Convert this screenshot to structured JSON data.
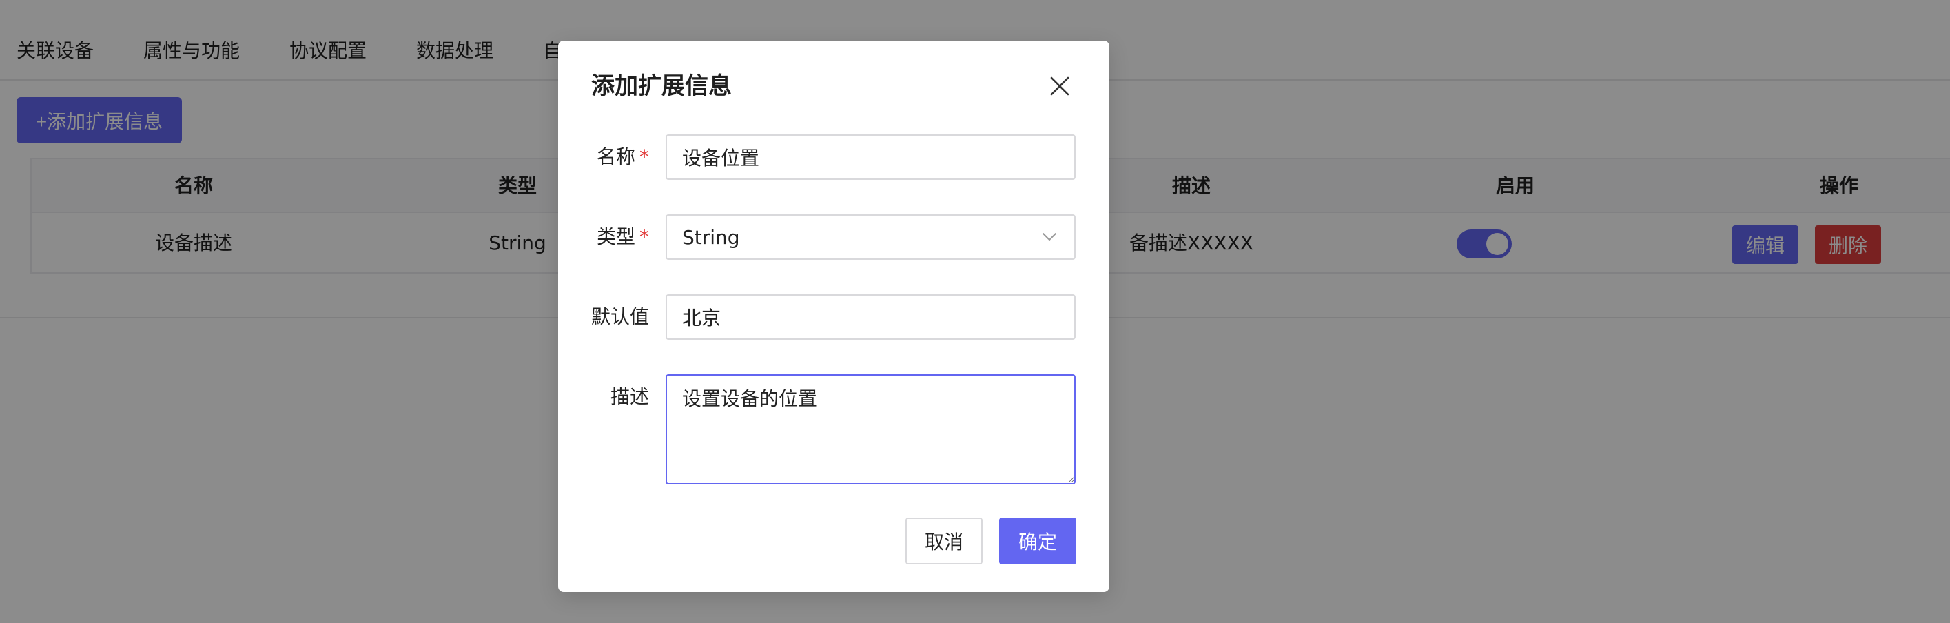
{
  "tabs": [
    "关联设备",
    "属性与功能",
    "协议配置",
    "数据处理",
    "自"
  ],
  "toolbar": {
    "add_label": "+添加扩展信息"
  },
  "table": {
    "columns": [
      "名称",
      "类型",
      "描述",
      "启用",
      "操作"
    ],
    "rows": [
      {
        "name": "设备描述",
        "type": "String",
        "desc": "备描述XXXXX",
        "enabled": true
      }
    ],
    "actions": {
      "edit": "编辑",
      "delete": "删除"
    }
  },
  "modal": {
    "title": "添加扩展信息",
    "fields": {
      "name": {
        "label": "名称",
        "required_mark": "*",
        "value": "设备位置"
      },
      "type": {
        "label": "类型",
        "required_mark": "*",
        "value": "String"
      },
      "default": {
        "label": "默认值",
        "value": "北京"
      },
      "description": {
        "label": "描述",
        "value": "设置设备的位置"
      }
    },
    "cancel_label": "取消",
    "ok_label": "确定"
  },
  "colors": {
    "primary": "#6366f1",
    "danger": "#dc3c3c",
    "required": "#e03131"
  }
}
